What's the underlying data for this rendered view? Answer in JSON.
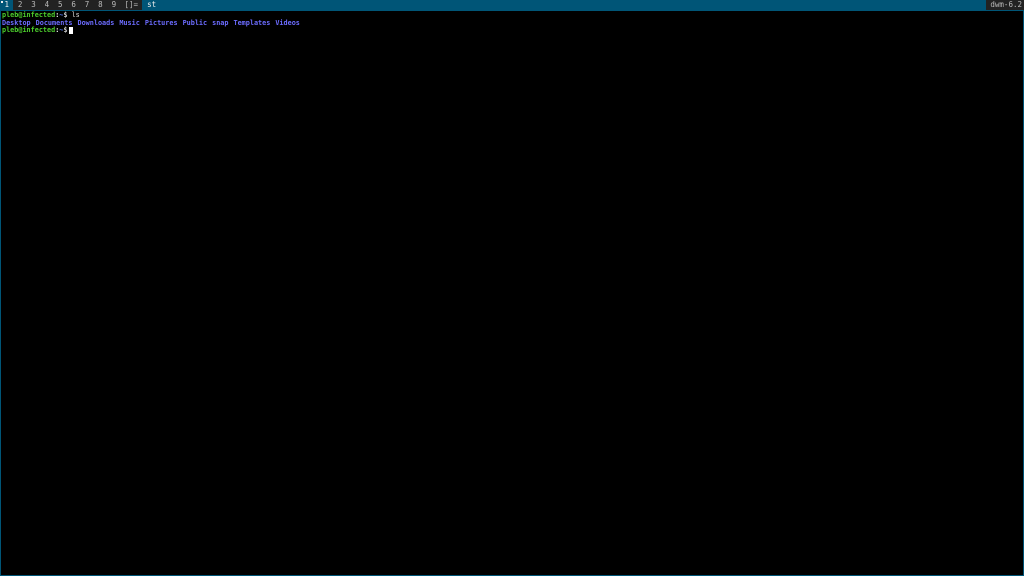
{
  "bar": {
    "tags": [
      "1",
      "2",
      "3",
      "4",
      "5",
      "6",
      "7",
      "8",
      "9"
    ],
    "layout_symbol": "[]=",
    "window_title": "st",
    "status": "dwm-6.2"
  },
  "terminal": {
    "line1": {
      "user": "pleb@infected",
      "sep": ":",
      "path": "~",
      "dollar": "$",
      "command": "ls"
    },
    "directories": [
      "Desktop",
      "Documents",
      "Downloads",
      "Music",
      "Pictures",
      "Public",
      "snap",
      "Templates",
      "Videos"
    ],
    "line3": {
      "user": "pleb@infected",
      "sep": ":",
      "path": "~",
      "dollar": "$"
    }
  },
  "colors": {
    "bar_background": "#005577",
    "prompt_user": "#4ccf2c",
    "directory": "#6c6cff"
  }
}
